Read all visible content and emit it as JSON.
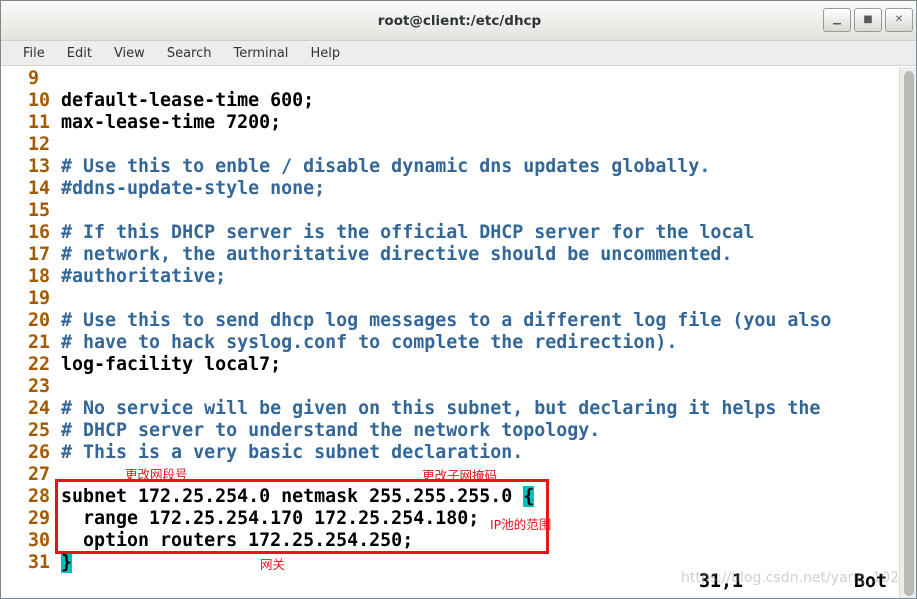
{
  "window": {
    "title": "root@client:/etc/dhcp"
  },
  "window_controls": {
    "minimize": "▁",
    "maximize": "■",
    "close": "✕"
  },
  "menu": [
    "File",
    "Edit",
    "View",
    "Search",
    "Terminal",
    "Help"
  ],
  "lines": [
    {
      "n": "9",
      "text": "",
      "type": "code"
    },
    {
      "n": "10",
      "text": "default-lease-time 600;",
      "type": "code"
    },
    {
      "n": "11",
      "text": "max-lease-time 7200;",
      "type": "code"
    },
    {
      "n": "12",
      "text": "",
      "type": "code"
    },
    {
      "n": "13",
      "text": "# Use this to enble / disable dynamic dns updates globally.",
      "type": "comment"
    },
    {
      "n": "14",
      "text": "#ddns-update-style none;",
      "type": "comment"
    },
    {
      "n": "15",
      "text": "",
      "type": "code"
    },
    {
      "n": "16",
      "text": "# If this DHCP server is the official DHCP server for the local",
      "type": "comment"
    },
    {
      "n": "17",
      "text": "# network, the authoritative directive should be uncommented.",
      "type": "comment"
    },
    {
      "n": "18",
      "text": "#authoritative;",
      "type": "comment"
    },
    {
      "n": "19",
      "text": "",
      "type": "code"
    },
    {
      "n": "20",
      "text": "# Use this to send dhcp log messages to a different log file (you also",
      "type": "comment"
    },
    {
      "n": "21",
      "text": "# have to hack syslog.conf to complete the redirection).",
      "type": "comment"
    },
    {
      "n": "22",
      "text": "log-facility local7;",
      "type": "code"
    },
    {
      "n": "23",
      "text": "",
      "type": "code"
    },
    {
      "n": "24",
      "text": "# No service will be given on this subnet, but declaring it helps the",
      "type": "comment"
    },
    {
      "n": "25",
      "text": "# DHCP server to understand the network topology.",
      "type": "comment"
    },
    {
      "n": "26",
      "text": "# This is a very basic subnet declaration.",
      "type": "comment"
    },
    {
      "n": "27",
      "text": "",
      "type": "code"
    },
    {
      "n": "28",
      "text": "subnet 172.25.254.0 netmask 255.255.255.0 ",
      "type": "code",
      "brace": "{"
    },
    {
      "n": "29",
      "text": "  range 172.25.254.170 172.25.254.180;",
      "type": "code"
    },
    {
      "n": "30",
      "text": "  option routers 172.25.254.250;",
      "type": "code"
    },
    {
      "n": "31",
      "text": "",
      "type": "code",
      "cursor": "}"
    }
  ],
  "status": {
    "position": "31,1",
    "scroll": "Bot"
  },
  "annotations": {
    "network_segment": "更改网段号",
    "subnet_mask": "更改子网掩码",
    "ip_pool_range": "IP池的范围",
    "gateway": "网关"
  },
  "watermark": "https://blog.csdn.net/yang_1024",
  "colors": {
    "line_number": "#a35a00",
    "comment": "#336699",
    "code": "#000000",
    "cursor_highlight": "#00bfbf",
    "annotation_red": "#e8141c"
  }
}
